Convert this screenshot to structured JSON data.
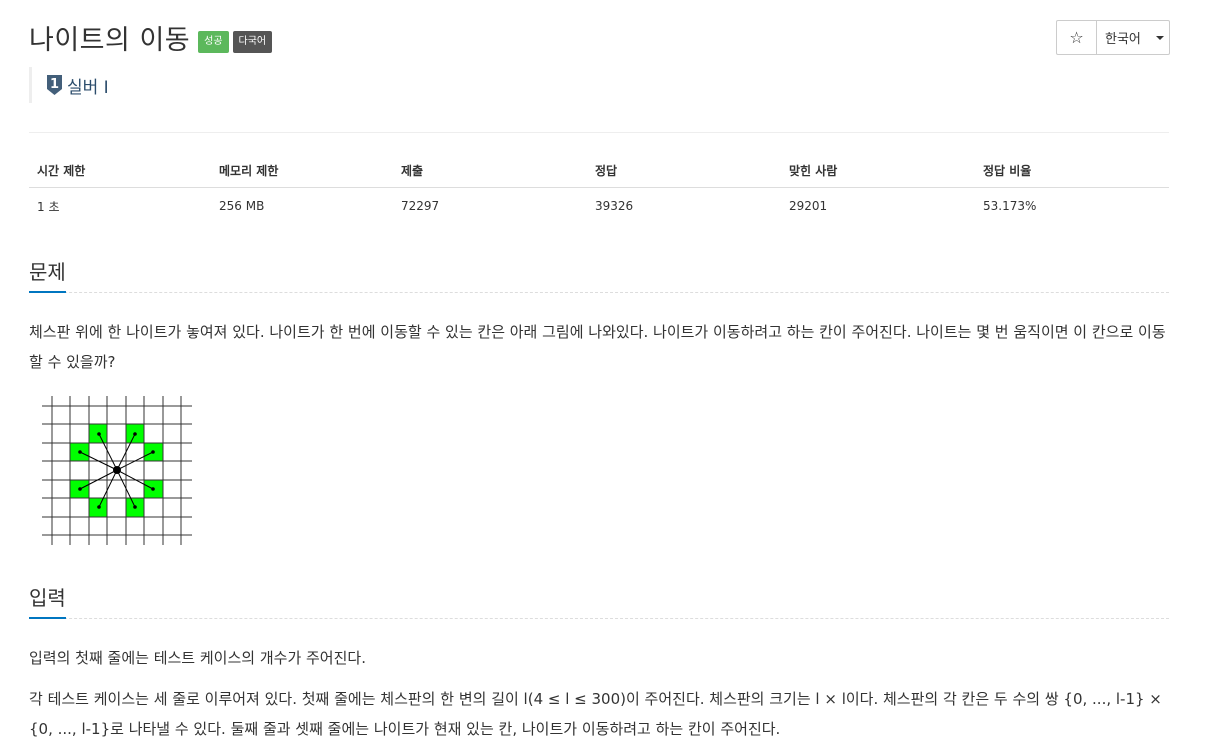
{
  "problem": {
    "title": "나이트의 이동",
    "badges": [
      "성공",
      "다국어"
    ]
  },
  "controls": {
    "star_icon": "star-icon",
    "language": "한국어"
  },
  "tier": {
    "label": "실버 I",
    "icon": "silver-tier-1-icon",
    "icon_number": "1",
    "color": "#435f7a"
  },
  "info_table": {
    "headers": [
      "시간 제한",
      "메모리 제한",
      "제출",
      "정답",
      "맞힌 사람",
      "정답 비율"
    ],
    "values": [
      "1 초",
      "256 MB",
      "72297",
      "39326",
      "29201",
      "53.173%"
    ]
  },
  "sections": {
    "problem": {
      "title": "문제",
      "text": "체스판 위에 한 나이트가 놓여져 있다. 나이트가 한 번에 이동할 수 있는 칸은 아래 그림에 나와있다. 나이트가 이동하려고 하는 칸이 주어진다. 나이트는 몇 번 움직이면 이 칸으로 이동할 수 있을까?"
    },
    "input": {
      "title": "입력",
      "p1": "입력의 첫째 줄에는 테스트 케이스의 개수가 주어진다.",
      "p2": "각 테스트 케이스는 세 줄로 이루어져 있다. 첫째 줄에는 체스판의 한 변의 길이 l(4 ≤ l ≤ 300)이 주어진다. 체스판의 크기는 l × l이다. 체스판의 각 칸은 두 수의 쌍 {0, ..., l-1} × {0, ..., l-1}로 나타낼 수 있다. 둘째 줄과 셋째 줄에는 나이트가 현재 있는 칸, 나이트가 이동하려고 하는 칸이 주어진다."
    }
  },
  "colors": {
    "success": "#5cb85c",
    "multilang": "#555555",
    "accent": "#0076c0",
    "highlight_cell": "#00ff00"
  }
}
